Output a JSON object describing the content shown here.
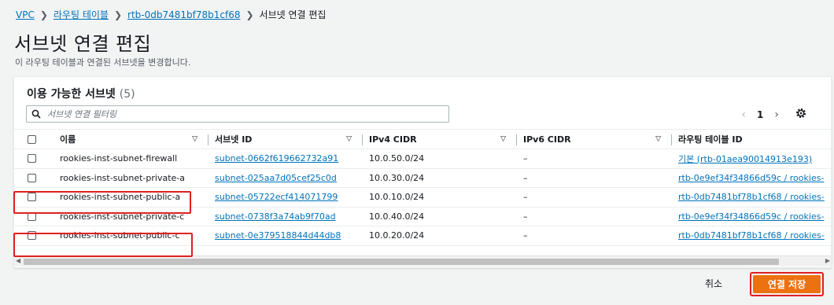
{
  "breadcrumb": {
    "items": [
      "VPC",
      "라우팅 테이블",
      "rtb-0db7481bf78b1cf68"
    ],
    "current": "서브넷 연결 편집"
  },
  "page": {
    "title": "서브넷 연결 편집",
    "description": "이 라우팅 테이블과 연결된 서브넷을 변경합니다."
  },
  "panel": {
    "title": "이용 가능한 서브넷",
    "count": "(5)",
    "filter_placeholder": "서브넷 연결 필터링",
    "page_number": "1"
  },
  "table": {
    "columns": [
      "이름",
      "서브넷 ID",
      "IPv4 CIDR",
      "IPv6 CIDR",
      "라우팅 테이블 ID"
    ],
    "rows": [
      {
        "name": "rookies-inst-subnet-firewall",
        "subnet_id": "subnet-0662f619662732a91",
        "ipv4": "10.0.50.0/24",
        "ipv6": "–",
        "route_table": "기본 (rtb-01aea90014913e193)",
        "checked": false,
        "highlighted": false
      },
      {
        "name": "rookies-inst-subnet-private-a",
        "subnet_id": "subnet-025aa7d05cef25c0d",
        "ipv4": "10.0.30.0/24",
        "ipv6": "–",
        "route_table": "rtb-0e9ef34f34866d59c / rookies-",
        "checked": false,
        "highlighted": false
      },
      {
        "name": "rookies-inst-subnet-public-a",
        "subnet_id": "subnet-05722ecf414071799",
        "ipv4": "10.0.10.0/24",
        "ipv6": "–",
        "route_table": "rtb-0db7481bf78b1cf68 / rookies-",
        "checked": false,
        "highlighted": true
      },
      {
        "name": "rookies-inst-subnet-private-c",
        "subnet_id": "subnet-0738f3a74ab9f70ad",
        "ipv4": "10.0.40.0/24",
        "ipv6": "–",
        "route_table": "rtb-0e9ef34f34866d59c / rookies-",
        "checked": false,
        "highlighted": false
      },
      {
        "name": "rookies-inst-subnet-public-c",
        "subnet_id": "subnet-0e379518844d44db8",
        "ipv4": "10.0.20.0/24",
        "ipv6": "–",
        "route_table": "rtb-0db7481bf78b1cf68 / rookies-",
        "checked": false,
        "highlighted": true
      }
    ]
  },
  "footer": {
    "cancel_label": "취소",
    "save_label": "연결 저장"
  },
  "colors": {
    "link": "#0073bb",
    "primary_button": "#ec7211",
    "highlight_box": "#e02020"
  }
}
